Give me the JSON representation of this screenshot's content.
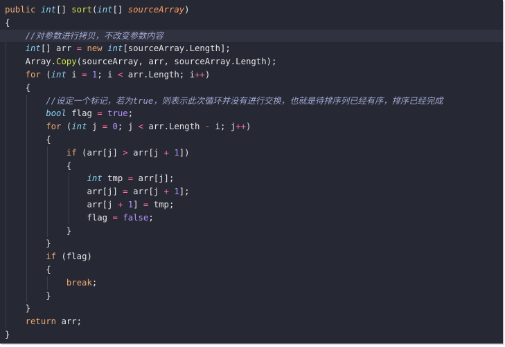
{
  "lines": [
    [
      {
        "t": "public",
        "c": "kw"
      },
      {
        "t": " ",
        "c": "tx"
      },
      {
        "t": "int",
        "c": "ty"
      },
      {
        "t": "[] ",
        "c": "tx"
      },
      {
        "t": "sort",
        "c": "fn"
      },
      {
        "t": "(",
        "c": "tx"
      },
      {
        "t": "int",
        "c": "ty"
      },
      {
        "t": "[] ",
        "c": "tx"
      },
      {
        "t": "sourceArray",
        "c": "pm"
      },
      {
        "t": ")",
        "c": "tx"
      }
    ],
    [
      {
        "t": "{",
        "c": "tx"
      }
    ],
    [
      {
        "t": "    ",
        "c": "tx"
      },
      {
        "t": "//对参数进行拷贝，不改变参数内容",
        "c": "cm"
      }
    ],
    [
      {
        "t": "    ",
        "c": "tx"
      },
      {
        "t": "int",
        "c": "ty"
      },
      {
        "t": "[] arr ",
        "c": "tx"
      },
      {
        "t": "=",
        "c": "op"
      },
      {
        "t": " ",
        "c": "tx"
      },
      {
        "t": "new",
        "c": "kw"
      },
      {
        "t": " ",
        "c": "tx"
      },
      {
        "t": "int",
        "c": "ty"
      },
      {
        "t": "[sourceArray.Length];",
        "c": "tx"
      }
    ],
    [
      {
        "t": "    ",
        "c": "tx"
      },
      {
        "t": "Array.",
        "c": "tx"
      },
      {
        "t": "Copy",
        "c": "fn"
      },
      {
        "t": "(sourceArray, arr, sourceArray.Length);",
        "c": "tx"
      }
    ],
    [
      {
        "t": "    ",
        "c": "tx"
      },
      {
        "t": "for",
        "c": "kw"
      },
      {
        "t": " (",
        "c": "tx"
      },
      {
        "t": "int",
        "c": "ty"
      },
      {
        "t": " i ",
        "c": "tx"
      },
      {
        "t": "=",
        "c": "op"
      },
      {
        "t": " ",
        "c": "tx"
      },
      {
        "t": "1",
        "c": "num"
      },
      {
        "t": "; i ",
        "c": "tx"
      },
      {
        "t": "<",
        "c": "op"
      },
      {
        "t": " arr.Length; i",
        "c": "tx"
      },
      {
        "t": "++",
        "c": "op"
      },
      {
        "t": ")",
        "c": "tx"
      }
    ],
    [
      {
        "t": "    ",
        "c": "tx"
      },
      {
        "t": "{",
        "c": "tx"
      }
    ],
    [
      {
        "t": "        ",
        "c": "tx"
      },
      {
        "t": "//设定一个标记，若为true，则表示此次循环并没有进行交换，也就是待排序列已经有序，排序已经完成",
        "c": "cm"
      }
    ],
    [
      {
        "t": "        ",
        "c": "tx"
      },
      {
        "t": "bool",
        "c": "ty"
      },
      {
        "t": " flag ",
        "c": "tx"
      },
      {
        "t": "=",
        "c": "op"
      },
      {
        "t": " ",
        "c": "tx"
      },
      {
        "t": "true",
        "c": "num"
      },
      {
        "t": ";",
        "c": "tx"
      }
    ],
    [
      {
        "t": "        ",
        "c": "tx"
      },
      {
        "t": "for",
        "c": "kw"
      },
      {
        "t": " (",
        "c": "tx"
      },
      {
        "t": "int",
        "c": "ty"
      },
      {
        "t": " j ",
        "c": "tx"
      },
      {
        "t": "=",
        "c": "op"
      },
      {
        "t": " ",
        "c": "tx"
      },
      {
        "t": "0",
        "c": "num"
      },
      {
        "t": "; j ",
        "c": "tx"
      },
      {
        "t": "<",
        "c": "op"
      },
      {
        "t": " arr.Length ",
        "c": "tx"
      },
      {
        "t": "-",
        "c": "op"
      },
      {
        "t": " i; j",
        "c": "tx"
      },
      {
        "t": "++",
        "c": "op"
      },
      {
        "t": ")",
        "c": "tx"
      }
    ],
    [
      {
        "t": "        ",
        "c": "tx"
      },
      {
        "t": "{",
        "c": "tx"
      }
    ],
    [
      {
        "t": "            ",
        "c": "tx"
      },
      {
        "t": "if",
        "c": "kw"
      },
      {
        "t": " (arr[j] ",
        "c": "tx"
      },
      {
        "t": ">",
        "c": "op"
      },
      {
        "t": " arr[j ",
        "c": "tx"
      },
      {
        "t": "+",
        "c": "op"
      },
      {
        "t": " ",
        "c": "tx"
      },
      {
        "t": "1",
        "c": "num"
      },
      {
        "t": "])",
        "c": "tx"
      }
    ],
    [
      {
        "t": "            ",
        "c": "tx"
      },
      {
        "t": "{",
        "c": "tx"
      }
    ],
    [
      {
        "t": "                ",
        "c": "tx"
      },
      {
        "t": "int",
        "c": "ty"
      },
      {
        "t": " tmp ",
        "c": "tx"
      },
      {
        "t": "=",
        "c": "op"
      },
      {
        "t": " arr[j];",
        "c": "tx"
      }
    ],
    [
      {
        "t": "                ",
        "c": "tx"
      },
      {
        "t": "arr[j] ",
        "c": "tx"
      },
      {
        "t": "=",
        "c": "op"
      },
      {
        "t": " arr[j ",
        "c": "tx"
      },
      {
        "t": "+",
        "c": "op"
      },
      {
        "t": " ",
        "c": "tx"
      },
      {
        "t": "1",
        "c": "num"
      },
      {
        "t": "];",
        "c": "tx"
      }
    ],
    [
      {
        "t": "                ",
        "c": "tx"
      },
      {
        "t": "arr[j ",
        "c": "tx"
      },
      {
        "t": "+",
        "c": "op"
      },
      {
        "t": " ",
        "c": "tx"
      },
      {
        "t": "1",
        "c": "num"
      },
      {
        "t": "] ",
        "c": "tx"
      },
      {
        "t": "=",
        "c": "op"
      },
      {
        "t": " tmp;",
        "c": "tx"
      }
    ],
    [
      {
        "t": "                ",
        "c": "tx"
      },
      {
        "t": "flag ",
        "c": "tx"
      },
      {
        "t": "=",
        "c": "op"
      },
      {
        "t": " ",
        "c": "tx"
      },
      {
        "t": "false",
        "c": "num"
      },
      {
        "t": ";",
        "c": "tx"
      }
    ],
    [
      {
        "t": "            ",
        "c": "tx"
      },
      {
        "t": "}",
        "c": "tx"
      }
    ],
    [
      {
        "t": "        ",
        "c": "tx"
      },
      {
        "t": "}",
        "c": "tx"
      }
    ],
    [
      {
        "t": "        ",
        "c": "tx"
      },
      {
        "t": "if",
        "c": "kw"
      },
      {
        "t": " (flag)",
        "c": "tx"
      }
    ],
    [
      {
        "t": "        ",
        "c": "tx"
      },
      {
        "t": "{",
        "c": "tx"
      }
    ],
    [
      {
        "t": "            ",
        "c": "tx"
      },
      {
        "t": "break",
        "c": "kw"
      },
      {
        "t": ";",
        "c": "tx"
      }
    ],
    [
      {
        "t": "        ",
        "c": "tx"
      },
      {
        "t": "}",
        "c": "tx"
      }
    ],
    [
      {
        "t": "    ",
        "c": "tx"
      },
      {
        "t": "}",
        "c": "tx"
      }
    ],
    [
      {
        "t": "    ",
        "c": "tx"
      },
      {
        "t": "return",
        "c": "kw"
      },
      {
        "t": " arr;",
        "c": "tx"
      }
    ],
    [
      {
        "t": "}",
        "c": "tx"
      }
    ]
  ],
  "highlighted_line": 2,
  "colors": {
    "background": "#262834",
    "keyword": "#f0a96e",
    "type": "#8ad4f4",
    "function": "#cfe24d",
    "parameter": "#ff9d5c",
    "operator": "#ff6f9a",
    "number": "#b595ff",
    "comment": "#a2a8d0",
    "text": "#e6e6e6"
  }
}
